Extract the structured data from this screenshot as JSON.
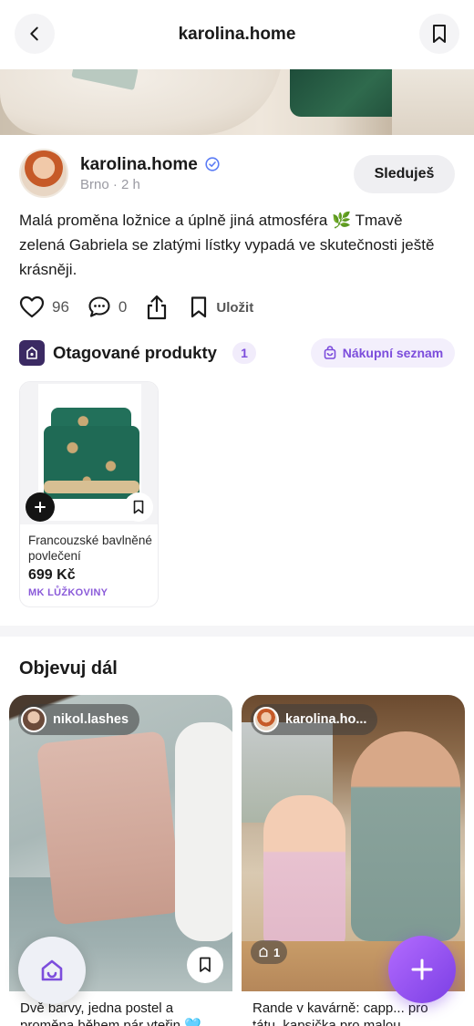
{
  "header": {
    "title": "karolina.home"
  },
  "post": {
    "author": {
      "name": "karolina.home",
      "meta": "Brno · 2 h",
      "follow_label": "Sleduješ"
    },
    "caption": "Malá proměna ložnice a úplně jiná atmosféra 🌿  Tmavě zelená Gabriela se zlatými lístky vypadá ve skutečnosti ještě krásněji.",
    "likes": "96",
    "comments": "0",
    "save_label": "Uložit"
  },
  "tagged": {
    "title": "Otagované produkty",
    "count": "1",
    "shopping_list_label": "Nákupní seznam",
    "products": [
      {
        "name": "Francouzské bavlněné povlečení",
        "price": "699 Kč",
        "shop": "MK LŮŽKOVINY"
      }
    ]
  },
  "discover": {
    "title": "Objevuj dál",
    "cards": [
      {
        "user": "nikol.lashes",
        "caption": "Dvě barvy, jedna postel a proměna během pár vteřin 🩵"
      },
      {
        "user": "karolina.ho...",
        "badge_count": "1",
        "caption": "Rande v kavárně: capp... pro tátu, kapsička pro malou"
      }
    ]
  },
  "colors": {
    "accent": "#7c4ddc",
    "verified": "#5b7cf5",
    "fab": "#8a4cf0"
  },
  "icons": [
    "back-arrow-icon",
    "bookmark-icon",
    "verified-icon",
    "heart-icon",
    "comment-icon",
    "share-icon",
    "shop-bag-icon",
    "cart-icon",
    "plus-icon",
    "home-icon"
  ]
}
